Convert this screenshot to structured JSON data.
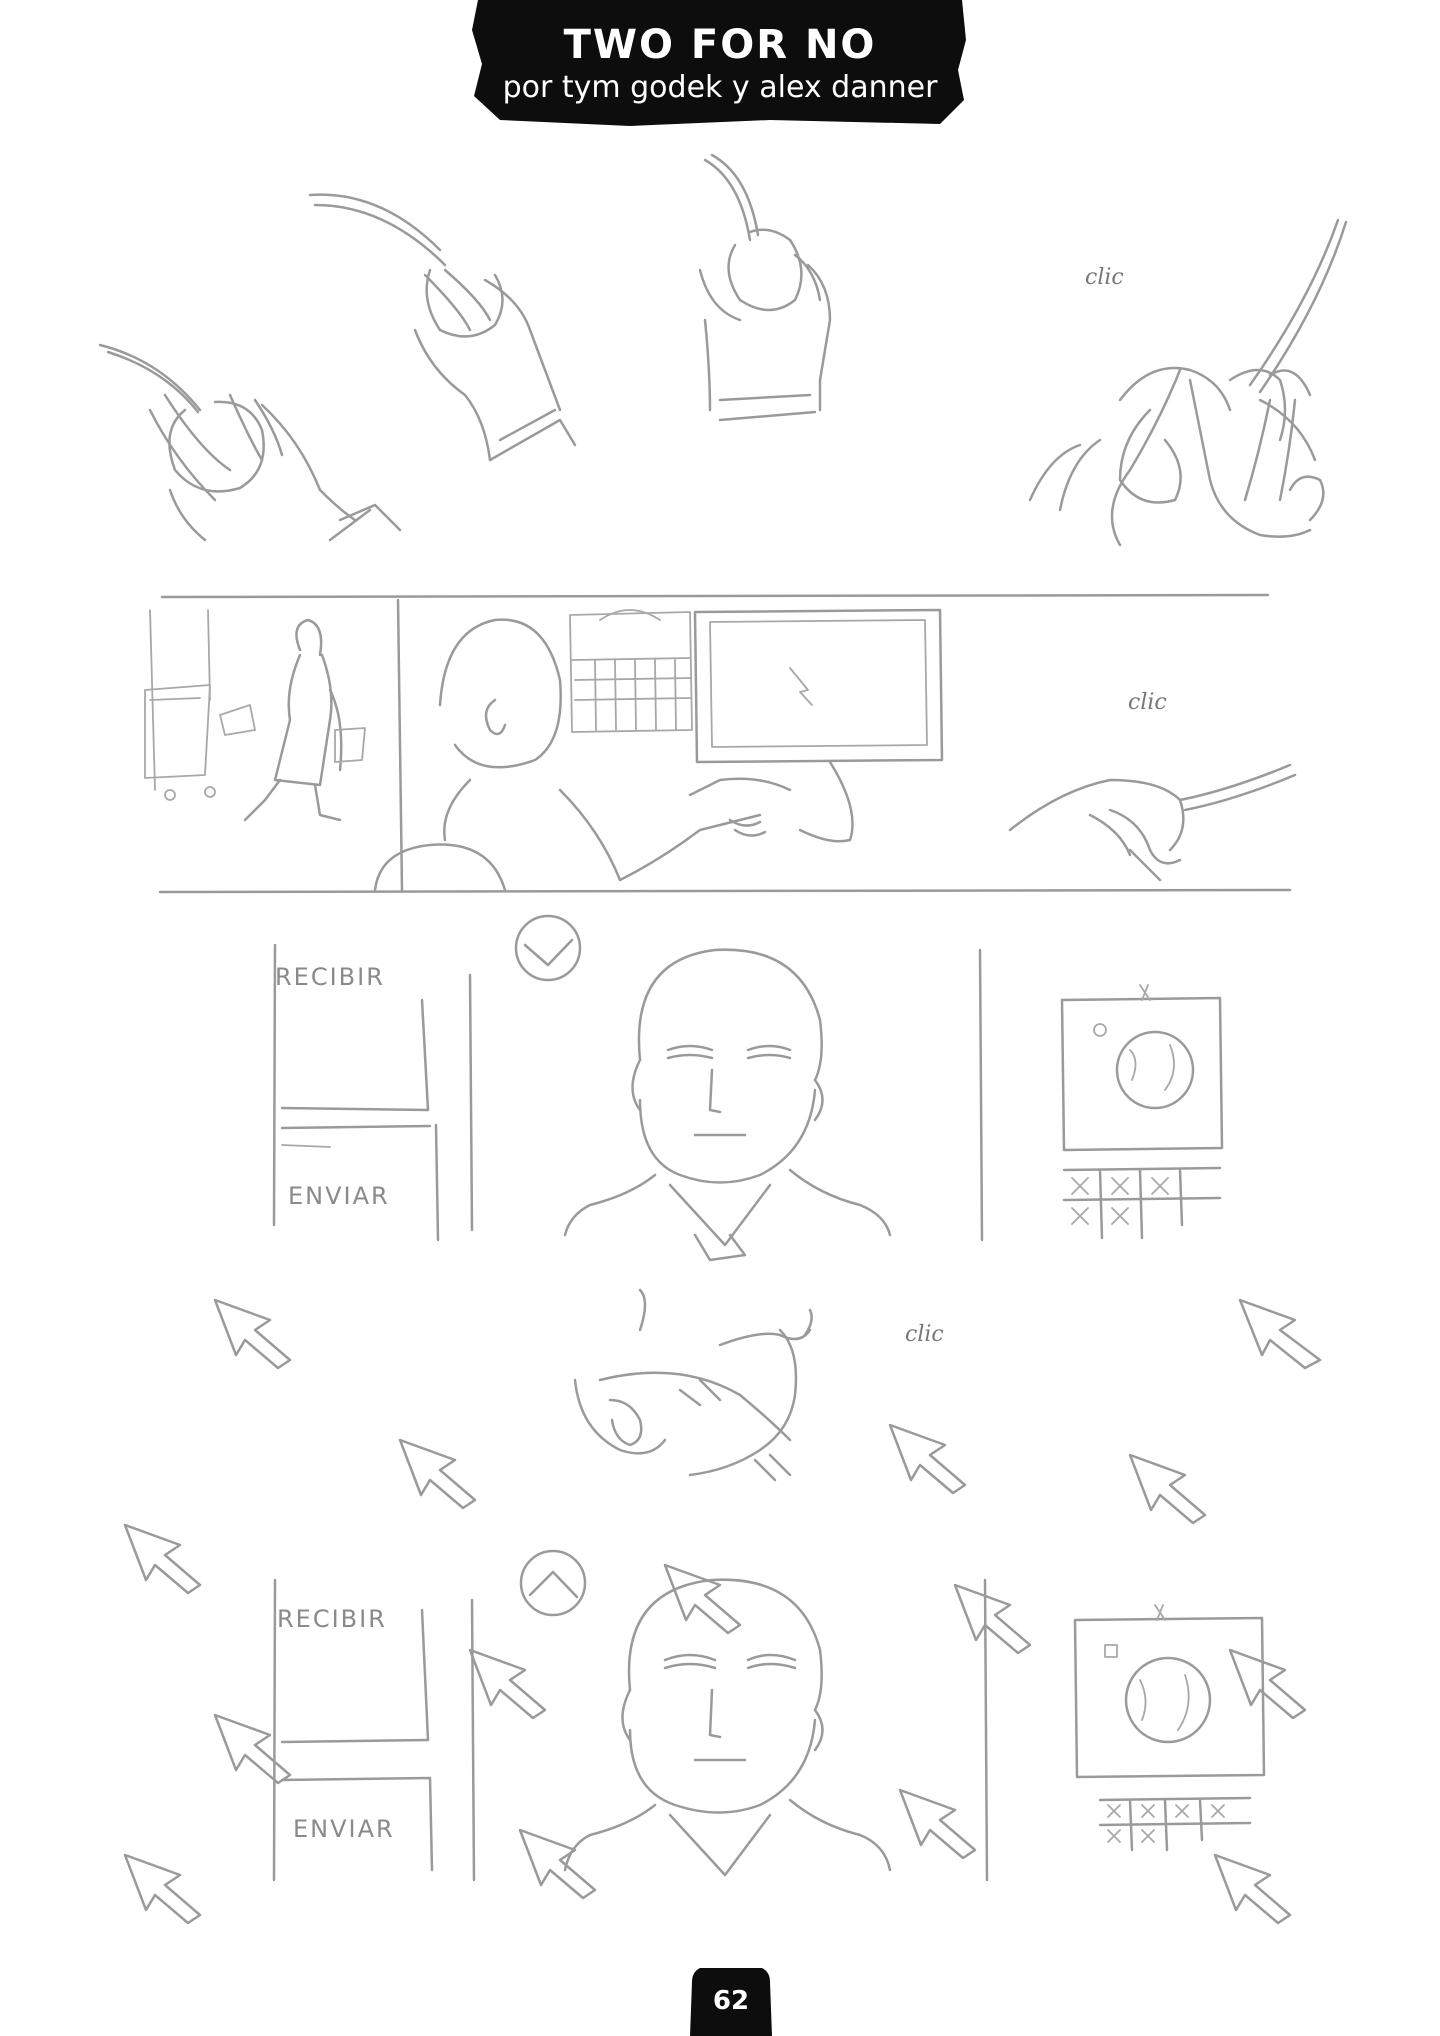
{
  "header": {
    "title": "TWO FOR NO",
    "credits": "por tym godek y alex danner"
  },
  "sound_effects": {
    "panel1": "clic",
    "panel2": "clic",
    "panel4": "clic"
  },
  "screen_labels": {
    "panel3_receive": "RECIBIR",
    "panel3_send": "ENVIAR",
    "panel5_receive": "RECIBIR",
    "panel5_send": "ENVIAR"
  },
  "footer": {
    "page_number": "62"
  },
  "colors": {
    "banner": "#0d0d0d",
    "pencil": "#9a9a9a",
    "background": "#ffffff"
  }
}
